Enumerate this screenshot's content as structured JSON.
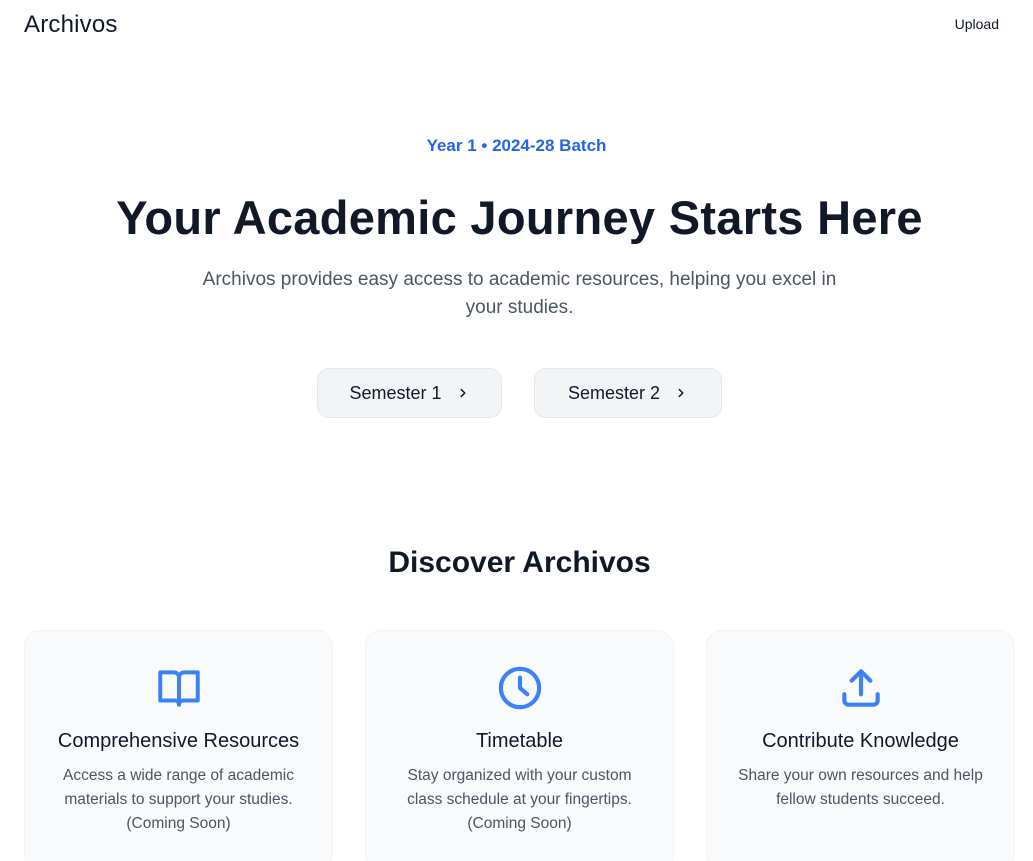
{
  "header": {
    "brand": "Archivos",
    "upload_label": "Upload"
  },
  "hero": {
    "eyebrow": "Year 1 • 2024-28 Batch",
    "title": "Your Academic Journey Starts Here",
    "subtitle": "Archivos provides easy access to academic resources, helping you excel in your studies.",
    "buttons": [
      {
        "label": "Semester 1",
        "icon": "chevron-right-icon"
      },
      {
        "label": "Semester 2",
        "icon": "chevron-right-icon"
      }
    ]
  },
  "discover": {
    "title": "Discover Archivos",
    "accent_color": "#3b82f6",
    "cards": [
      {
        "icon": "book-open-icon",
        "title": "Comprehensive Resources",
        "description": "Access a wide range of academic materials to support your studies. (Coming Soon)"
      },
      {
        "icon": "clock-icon",
        "title": "Timetable",
        "description": "Stay organized with your custom class schedule at your fingertips. (Coming Soon)"
      },
      {
        "icon": "upload-icon",
        "title": "Contribute Knowledge",
        "description": "Share your own resources and help fellow students succeed."
      }
    ]
  }
}
